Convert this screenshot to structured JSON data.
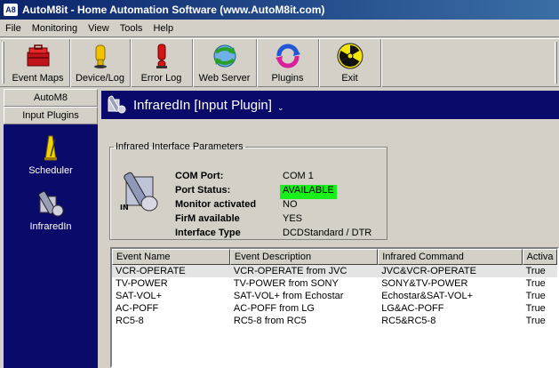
{
  "window": {
    "app_icon": "A8",
    "title": "AutoM8it - Home Automation Software (www.AutoM8it.com)"
  },
  "menu": [
    "File",
    "Monitoring",
    "View",
    "Tools",
    "Help"
  ],
  "toolbar": [
    {
      "label": "Event Maps",
      "icon": "toolbox-icon"
    },
    {
      "label": "Device/Log",
      "icon": "device-log-icon"
    },
    {
      "label": "Error Log",
      "icon": "error-log-icon"
    },
    {
      "label": "Web Server",
      "icon": "web-server-icon"
    },
    {
      "label": "Plugins",
      "icon": "plugins-icon"
    },
    {
      "label": "Exit",
      "icon": "exit-radiation-icon"
    }
  ],
  "sidebar": {
    "tabs": [
      "AutoM8",
      "Input Plugins"
    ],
    "items": [
      {
        "label": "Scheduler",
        "icon": "metronome-icon"
      },
      {
        "label": "InfraredIn",
        "icon": "remote-control-icon"
      }
    ]
  },
  "main": {
    "title": "InfraredIn [Input Plugin]",
    "caret": "⌄",
    "params": {
      "legend": "Infrared Interface Parameters",
      "rows": [
        {
          "label": "COM Port:",
          "value": "COM 1"
        },
        {
          "label": "Port Status:",
          "value": "AVAILABLE"
        },
        {
          "label": "Monitor activated",
          "value": "NO"
        },
        {
          "label": "FirM available",
          "value": "YES"
        },
        {
          "label": "Interface Type",
          "value": "DCDStandard / DTR"
        }
      ],
      "status_color": "#19f01b"
    },
    "events": {
      "columns": [
        "Event Name",
        "Event Description",
        "Infrared Command",
        "Activa"
      ],
      "rows": [
        [
          "VCR-OPERATE",
          "VCR-OPERATE from JVC",
          "JVC&VCR-OPERATE",
          "True"
        ],
        [
          "TV-POWER",
          "TV-POWER from SONY",
          "SONY&TV-POWER",
          "True"
        ],
        [
          "SAT-VOL+",
          "SAT-VOL+ from Echostar",
          "Echostar&SAT-VOL+",
          "True"
        ],
        [
          "AC-POFF",
          "AC-POFF from LG",
          "LG&AC-POFF",
          "True"
        ],
        [
          "RC5-8",
          "RC5-8 from RC5",
          "RC5&RC5-8",
          "True"
        ]
      ]
    }
  },
  "colors": {
    "title_bar": "#0a246a",
    "panel_navy": "#0a0a6b",
    "face": "#d4d0c8"
  }
}
